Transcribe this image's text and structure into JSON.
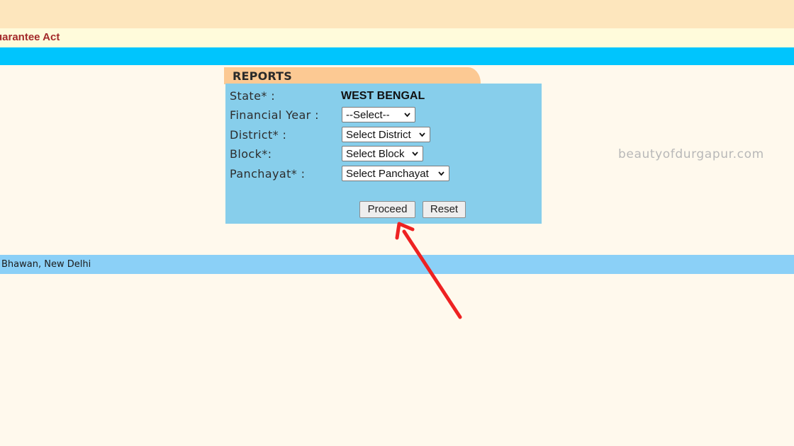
{
  "header": {
    "site_title": "uarantee Act"
  },
  "reports": {
    "tab_label": "REPORTS",
    "fields": {
      "state": {
        "label": "State* :",
        "value": "WEST BENGAL"
      },
      "financial_year": {
        "label": "Financial Year :",
        "selected": "--Select--"
      },
      "district": {
        "label": "District* :",
        "selected": "Select District"
      },
      "block": {
        "label": "Block*:",
        "selected": "Select Block"
      },
      "panchayat": {
        "label": "Panchayat* :",
        "selected": "Select Panchayat"
      }
    },
    "buttons": {
      "proceed": "Proceed",
      "reset": "Reset"
    }
  },
  "watermark": "beautyofdurgapur.com",
  "footer": {
    "text": "Bhawan, New Delhi"
  },
  "annotation": {
    "arrow_color": "#ee2222",
    "arrow_icon": "red-arrow-icon"
  },
  "colors": {
    "panel_bg": "#87ceeb",
    "tab_bg": "#fcc993",
    "top_blue": "#00c5fd",
    "footer_blue": "#8bd0f7",
    "title_red": "#a32a2a"
  }
}
